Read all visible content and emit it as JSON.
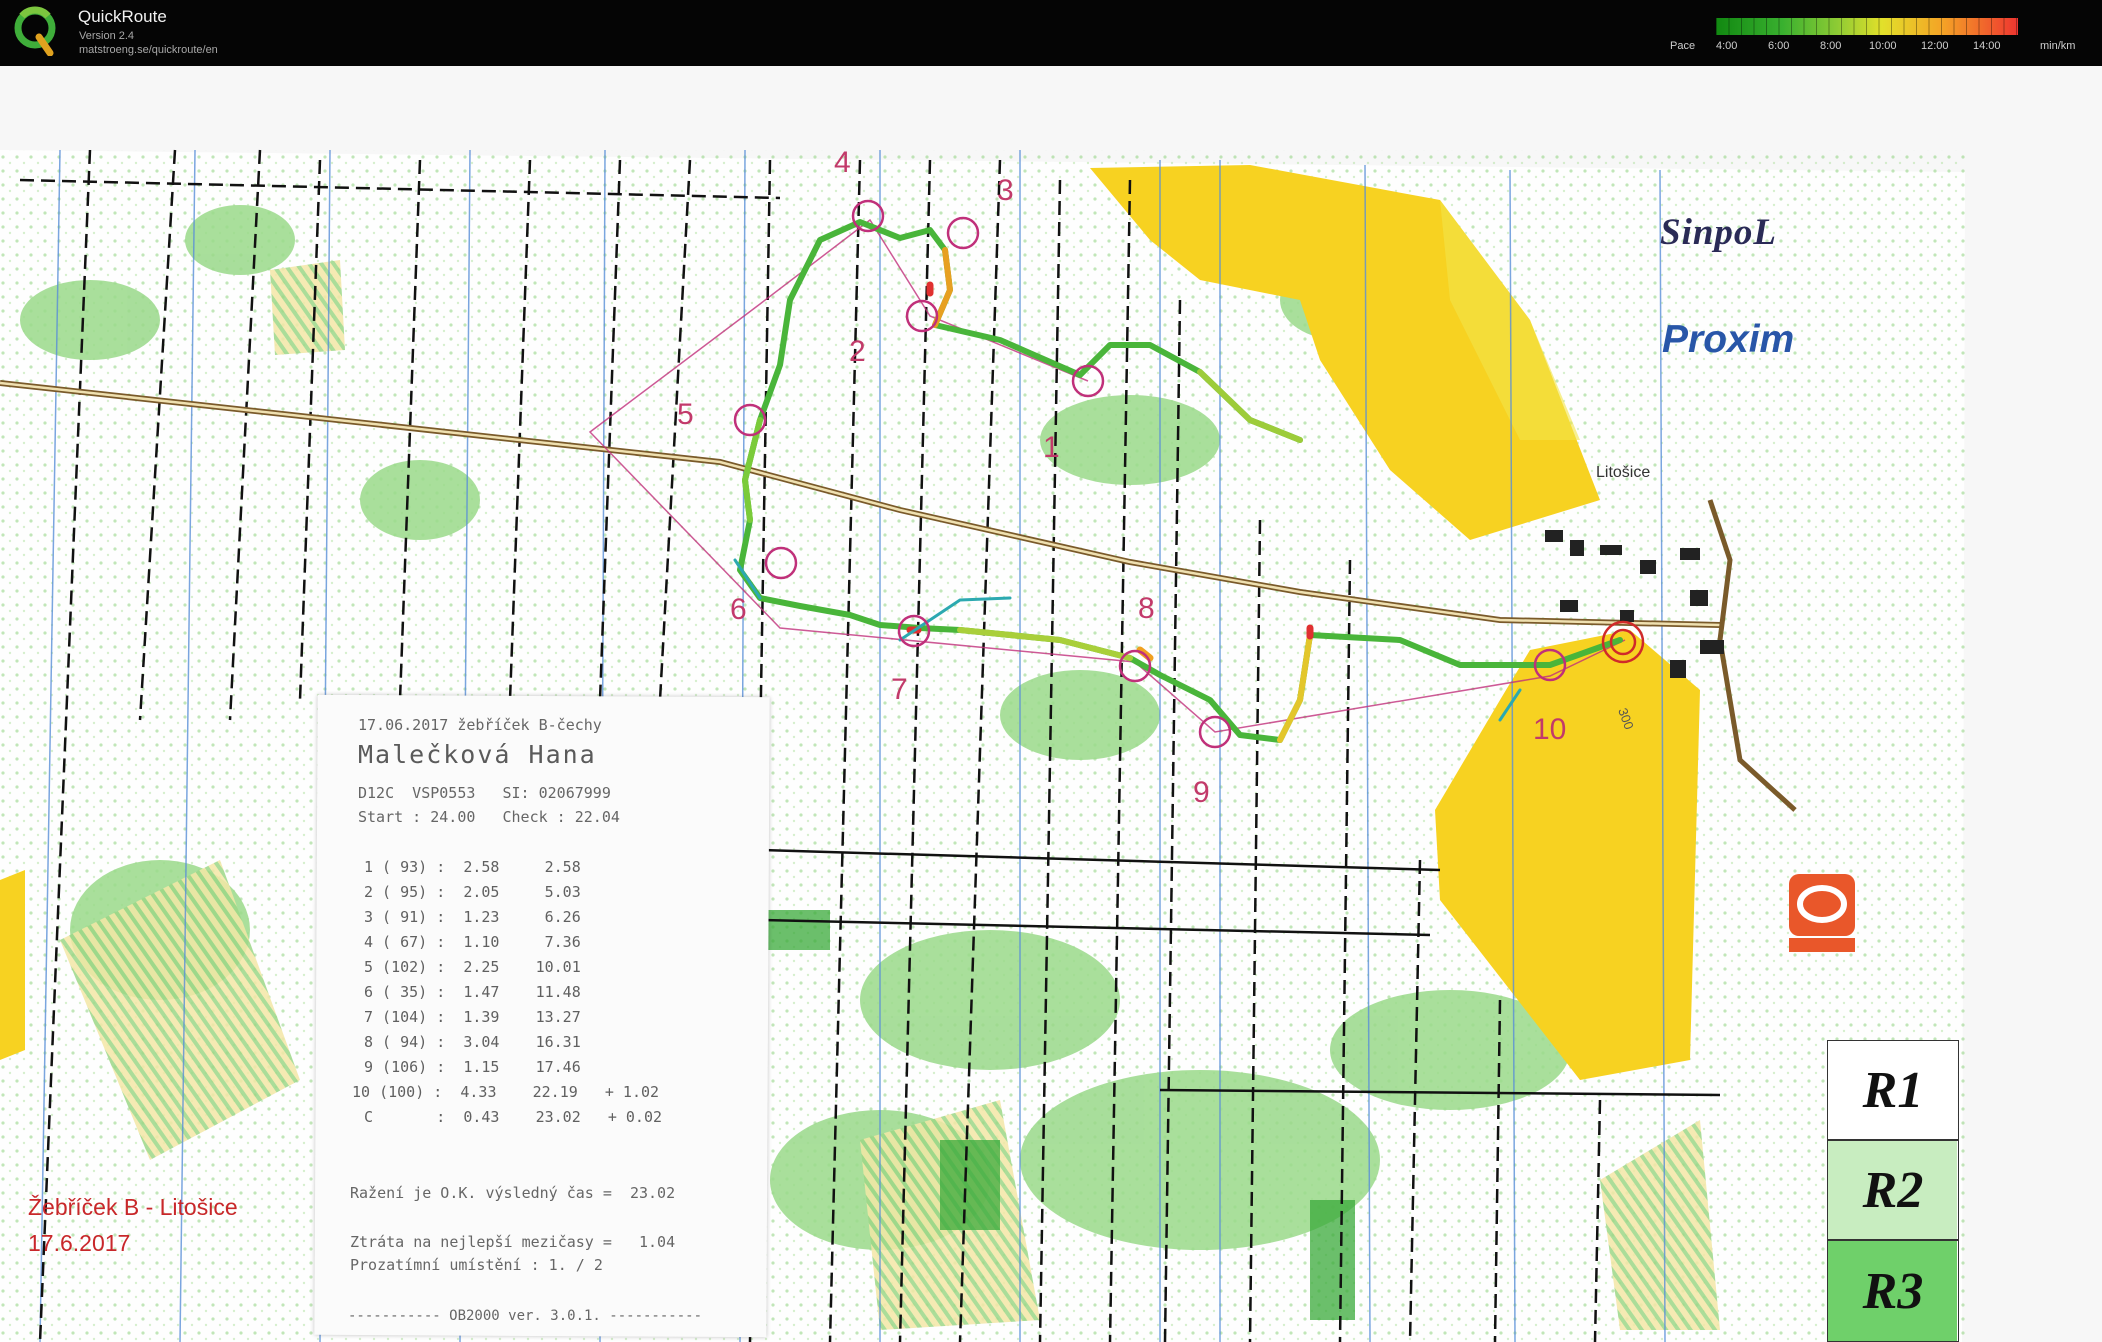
{
  "app": {
    "title": "QuickRoute",
    "version": "Version 2.4",
    "url": "matstroeng.se/quickroute/en",
    "logo_icon": "quickroute-q-logo"
  },
  "pace_scale": {
    "label": "Pace",
    "ticks": [
      "4:00",
      "6:00",
      "8:00",
      "10:00",
      "12:00",
      "14:00"
    ],
    "unit": "min/km",
    "colors": [
      "#118811",
      "#39b02f",
      "#8dcb34",
      "#e2e02a",
      "#f4a326",
      "#ee3530"
    ]
  },
  "map": {
    "title_line1": "Žebříček B - Litošice",
    "title_line2": "17.6.2017",
    "org1": "SinpoL",
    "org2": "Proxim",
    "village": "Litošice",
    "publisher_logo": "mapy-logo",
    "controls": [
      "1",
      "2",
      "3",
      "4",
      "5",
      "6",
      "7",
      "8",
      "9",
      "10"
    ],
    "route_levels": [
      "R1",
      "R2",
      "R3"
    ],
    "contour_label": "300"
  },
  "receipt": {
    "header": "17.06.2017 žebříček B-čechy",
    "name": "Malečková Hana",
    "class_line": "D12C  VSP0553   SI: 02067999",
    "start_line": "Start : 24.00   Check : 22.04",
    "splits": [
      "1 ( 93) :  2.58     2.58",
      "2 ( 95) :  2.05     5.03",
      "3 ( 91) :  1.23     6.26",
      "4 ( 67) :  1.10     7.36",
      "5 (102) :  2.25    10.01",
      "6 ( 35) :  1.47    11.48",
      "7 (104) :  1.39    13.27",
      "8 ( 94) :  3.04    16.31",
      "9 (106) :  1.15    17.46",
      "10 (100) :  4.33    22.19   + 1.02",
      "C       :  0.43    23.02   + 0.02"
    ],
    "result_line": "Ražení je O.K. výsledný čas =  23.02",
    "loss_line": "Ztráta na nejlepší mezičasy =   1.04",
    "position_line": "Prozatímní umístění : 1. / 2",
    "footer": "----------- OB2000 ver. 3.0.1. -----------"
  }
}
